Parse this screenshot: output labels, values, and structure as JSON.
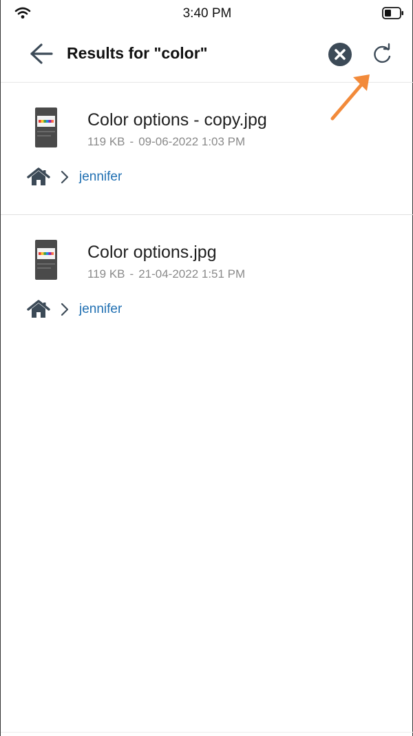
{
  "status_bar": {
    "time": "3:40 PM",
    "icons": [
      "wifi-icon",
      "battery-icon"
    ]
  },
  "header": {
    "title": "Results for \"color\"",
    "icons": [
      "back-arrow-icon",
      "clear-search-icon",
      "refresh-icon"
    ]
  },
  "colors": {
    "accent_link": "#1f6fb2",
    "annotation_arrow": "#f28a3a",
    "icon_dark": "#3c4a57"
  },
  "results": [
    {
      "name": "Color options - copy.jpg",
      "size": "119 KB",
      "separator": "-",
      "date": "09-06-2022 1:03 PM",
      "path_folder": "jennifer"
    },
    {
      "name": "Color options.jpg",
      "size": "119 KB",
      "separator": "-",
      "date": "21-04-2022 1:51 PM",
      "path_folder": "jennifer"
    }
  ]
}
